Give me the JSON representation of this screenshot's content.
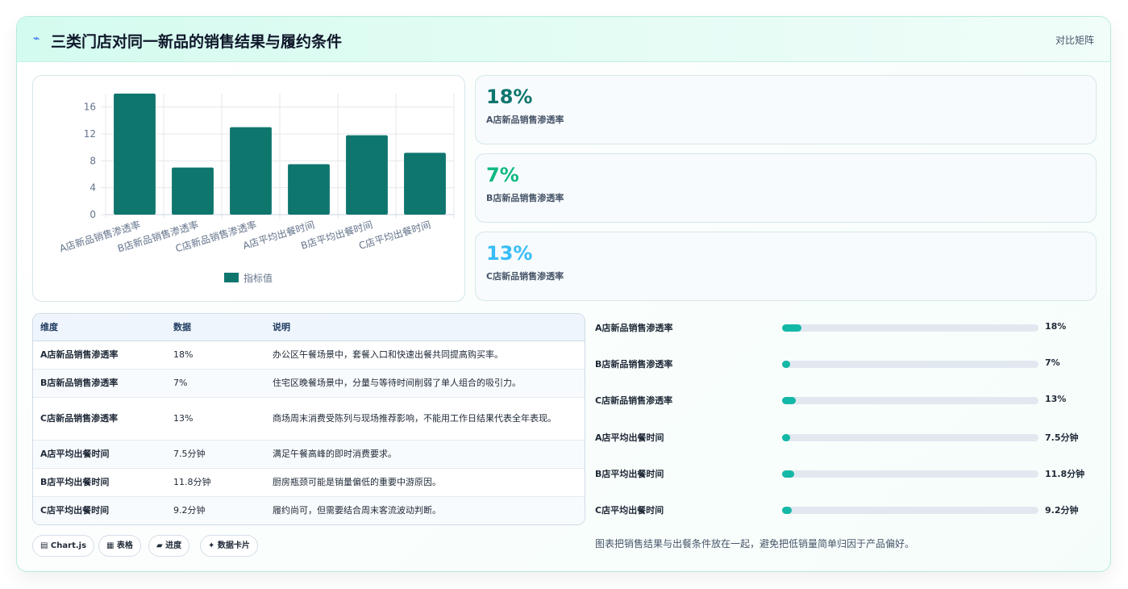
{
  "header": {
    "title": "三类门店对同一新品的销售结果与履约条件",
    "tag": "对比矩阵",
    "icon": "bolt-icon"
  },
  "chart_data": {
    "type": "bar",
    "categories": [
      "A店新品销售渗透率",
      "B店新品销售渗透率",
      "C店新品销售渗透率",
      "A店平均出餐时间",
      "B店平均出餐时间",
      "C店平均出餐时间"
    ],
    "series": [
      {
        "name": "指标值",
        "values": [
          18,
          7,
          13,
          7.5,
          11.8,
          9.2
        ],
        "color": "#0f766e"
      }
    ],
    "yticks": [
      0,
      4,
      8,
      12,
      16
    ],
    "ylim": [
      0,
      18
    ],
    "grid": true,
    "legend": "bottom"
  },
  "kpis": [
    {
      "value": "18%",
      "label": "A店新品销售渗透率",
      "color": "#0f766e"
    },
    {
      "value": "7%",
      "label": "B店新品销售渗透率",
      "color": "#10b981"
    },
    {
      "value": "13%",
      "label": "C店新品销售渗透率",
      "color": "#38bdf8"
    }
  ],
  "table": {
    "headers": [
      "维度",
      "数据",
      "说明"
    ],
    "rows": [
      [
        "A店新品销售渗透率",
        "18%",
        "办公区午餐场景中，套餐入口和快速出餐共同提高购买率。"
      ],
      [
        "B店新品销售渗透率",
        "7%",
        "住宅区晚餐场景中，分量与等待时间削弱了单人组合的吸引力。"
      ],
      [
        "C店新品销售渗透率",
        "13%",
        "商场周末消费受陈列与现场推荐影响，不能用工作日结果代表全年表现。"
      ],
      [
        "A店平均出餐时间",
        "7.5分钟",
        "满足午餐高峰的即时消费要求。"
      ],
      [
        "B店平均出餐时间",
        "11.8分钟",
        "厨房瓶颈可能是销量偏低的重要中游原因。"
      ],
      [
        "C店平均出餐时间",
        "9.2分钟",
        "履约尚可，但需要结合周末客流波动判断。"
      ]
    ]
  },
  "chips": [
    "▤ Chart.js",
    "▦ 表格",
    "▰ 进度",
    "✦ 数据卡片"
  ],
  "progress": [
    {
      "label": "A店新品销售渗透率",
      "value": "18%",
      "fraction": 0.075
    },
    {
      "label": "B店新品销售渗透率",
      "value": "7%",
      "fraction": 0.03
    },
    {
      "label": "C店新品销售渗透率",
      "value": "13%",
      "fraction": 0.055
    },
    {
      "label": "A店平均出餐时间",
      "value": "7.5分钟",
      "fraction": 0.03
    },
    {
      "label": "B店平均出餐时间",
      "value": "11.8分钟",
      "fraction": 0.048
    },
    {
      "label": "C店平均出餐时间",
      "value": "9.2分钟",
      "fraction": 0.037
    }
  ],
  "note": "图表把销售结果与出餐条件放在一起，避免把低销量简单归因于产品偏好。"
}
